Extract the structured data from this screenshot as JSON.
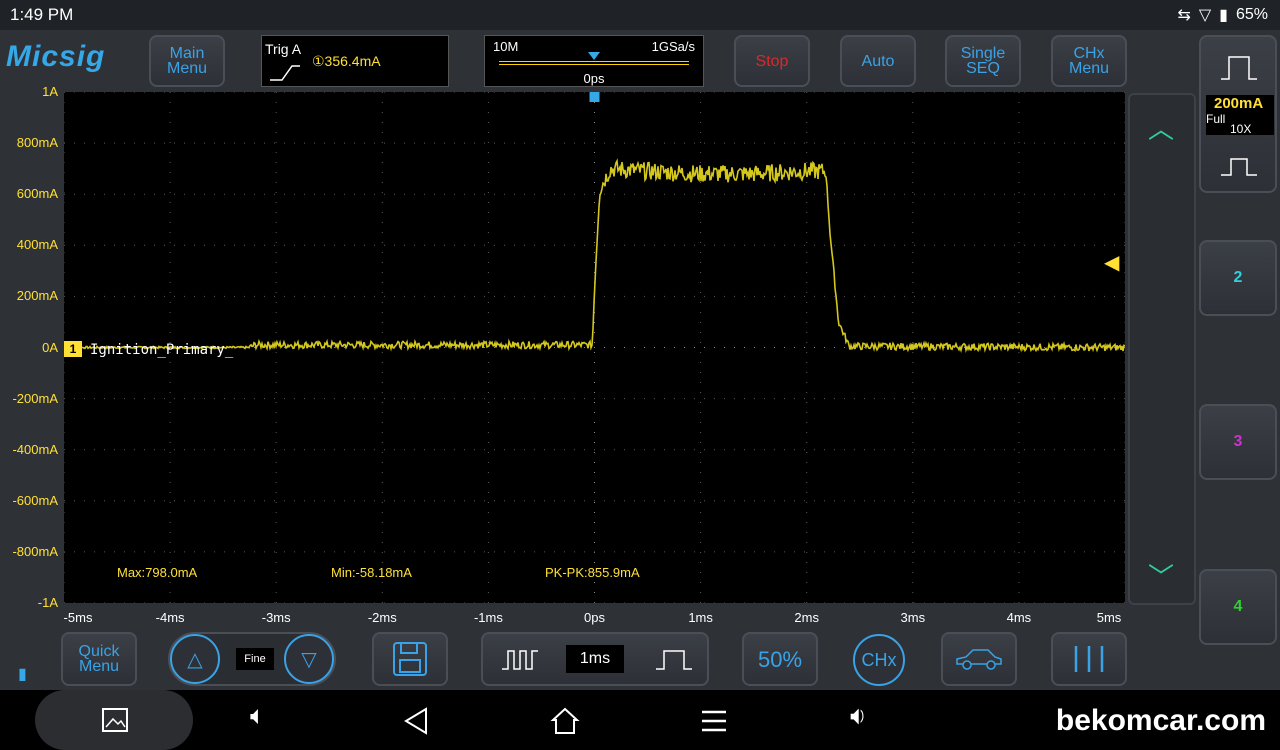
{
  "status": {
    "time": "1:49 PM",
    "battery": "65%"
  },
  "logo": "Micsig",
  "top": {
    "main_menu": "Main Menu",
    "trig_label": "Trig A",
    "trig_value": "①356.4mA",
    "memory": "10M",
    "sample_rate": "1GSa/s",
    "time_position": "0ps",
    "stop": "Stop",
    "auto": "Auto",
    "single_seq": "Single SEQ",
    "chx_menu": "CHx Menu"
  },
  "channel1": {
    "scale": "200mA",
    "coupling": "Full",
    "probe": "10X",
    "label": "1",
    "trace_name": "Ignition_Primary_"
  },
  "channels": [
    "2",
    "3",
    "4"
  ],
  "channel_colors": {
    "ch1": "#d4c81c",
    "ch2": "#2fd0e0",
    "ch3": "#d030d0",
    "ch4": "#30d030"
  },
  "measurements": {
    "max": "Max:798.0mA",
    "min": "Min:-58.18mA",
    "pkpk": "PK-PK:855.9mA"
  },
  "chart_data": {
    "type": "line",
    "yticks": [
      "1A",
      "800mA",
      "600mA",
      "400mA",
      "200mA",
      "0A",
      "-200mA",
      "-400mA",
      "-600mA",
      "-800mA",
      "-1A"
    ],
    "xticks": [
      "-5ms",
      "-4ms",
      "-3ms",
      "-2ms",
      "-1ms",
      "0ps",
      "1ms",
      "2ms",
      "3ms",
      "4ms",
      "5ms"
    ],
    "xlim": [
      -5,
      5
    ],
    "ylim": [
      -1000,
      1000
    ],
    "series": [
      {
        "name": "Ignition_Primary_",
        "x_ms": [
          -5,
          -3.25,
          -3.2,
          -0.02,
          0.0,
          0.05,
          0.15,
          0.5,
          1.0,
          1.5,
          2.0,
          2.18,
          2.22,
          2.3,
          2.4,
          5
        ],
        "y_mA": [
          0,
          0,
          10,
          10,
          230,
          620,
          700,
          690,
          680,
          680,
          690,
          690,
          450,
          100,
          5,
          0
        ]
      }
    ]
  },
  "bottom": {
    "quick_menu": "Quick Menu",
    "fine": "Fine",
    "timebase": "1ms",
    "fifty": "50%",
    "chx": "CHx"
  },
  "watermark": "bekomcar.com"
}
